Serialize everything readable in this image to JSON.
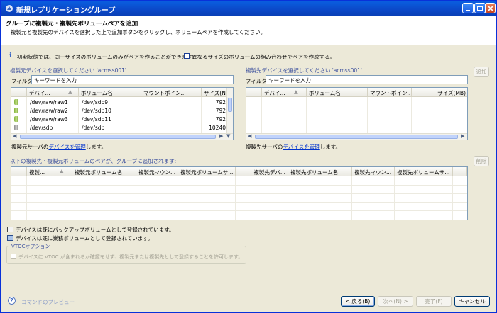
{
  "window": {
    "title": "新規レプリケーショングループ"
  },
  "banner": {
    "heading": "グループに複製元・複製先ボリュームペアを追加",
    "description": "複製元と複製先のデバイスを選択した上で追加ボタンをクリックし、ボリュームペアを作成してください。"
  },
  "info": {
    "icon": "info-icon",
    "text": "初期状態では、同一サイズのボリュームのみがペアを作ることができます。",
    "checkbox_label": "異なるサイズのボリュームの組み合わせでペアを作成する。",
    "checkbox_checked": false
  },
  "source": {
    "group_title": "複製元デバイスを選択してください 'acmss001'",
    "filter_label": "フィルタ:",
    "filter_value": "キーワードを入力",
    "columns": [
      "デバイ...",
      "ボリューム名",
      "マウントポイン...",
      "サイズ(N"
    ],
    "rows": [
      {
        "device": "/dev/raw/raw1",
        "volume": "/dev/sdb9",
        "mount": "",
        "size": "792"
      },
      {
        "device": "/dev/raw/raw2",
        "volume": "/dev/sdb10",
        "mount": "",
        "size": "792"
      },
      {
        "device": "/dev/raw/raw3",
        "volume": "/dev/sdb11",
        "mount": "",
        "size": "792"
      },
      {
        "device": "/dev/sdb",
        "volume": "/dev/sdb",
        "mount": "",
        "size": "10240"
      }
    ],
    "footer_prefix": "複製元サーバの",
    "footer_link": "デバイスを管理",
    "footer_suffix": "します。"
  },
  "target": {
    "group_title": "複製先デバイスを選択してください 'acmss001'",
    "filter_label": "フィルタ:",
    "filter_value": "キーワードを入力",
    "columns": [
      "デバイ...",
      "ボリューム名",
      "マウントポイン...",
      "サイズ(MB)"
    ],
    "footer_prefix": "複製先サーバの",
    "footer_link": "デバイスを管理",
    "footer_suffix": "します。"
  },
  "buttons": {
    "add": "追加",
    "remove": "削除",
    "back": "< 戻る(B)",
    "next": "次へ(N) >",
    "finish": "完了(F)",
    "cancel": "キャンセル"
  },
  "pairs": {
    "group_title": "以下の複製先・複製元ボリュームのペアが、グループに追加されます:",
    "columns": [
      "複製...",
      "複製元ボリューム名",
      "複製元マウン...",
      "複製元ボリュームサ...",
      "複製先デバ...",
      "複製先ボリューム名",
      "複製先マウン...",
      "複製先ボリュームサ..."
    ]
  },
  "legend": {
    "backup": "デバイスは既にバックアップボリュームとして登録されています。",
    "business": "デバイスは既に業務ボリュームとして登録されています。"
  },
  "vtoc": {
    "group_title": "VTOCオプション",
    "checkbox_label": "デバイスに VTOC が含まれるか確認をせず、複製元または複製先として登録することを許可します。"
  },
  "footer": {
    "help_icon": "help-icon",
    "preview_link": "コマンドのプレビュー"
  },
  "colors": {
    "title_bar": "#0b48c8",
    "link": "#0033cc",
    "group_title": "#3b4f9d"
  }
}
